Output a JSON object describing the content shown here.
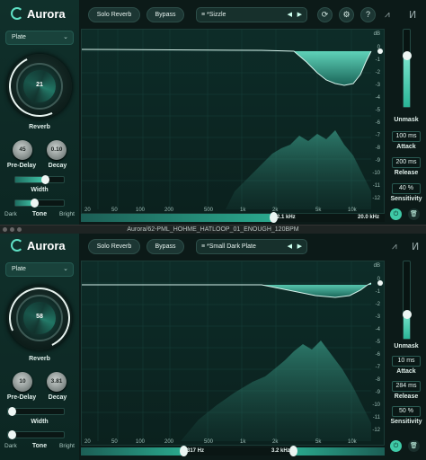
{
  "window_title": "Aurora/62-PML_HOHME_HATLOOP_01_ENOUGH_120BPM",
  "instances": [
    {
      "logo": "Aurora",
      "preset_type": "Plate",
      "solo_label": "Solo Reverb",
      "bypass_label": "Bypass",
      "preset_name": "*Sizzle",
      "reverb_value": "21",
      "reverb_label": "Reverb",
      "predelay_value": "45",
      "predelay_label": "Pre-Delay",
      "decay_value": "0.10",
      "decay_label": "Decay",
      "width_label": "Width",
      "width_level": 0.62,
      "tone_left": "Dark",
      "tone_label": "Tone",
      "tone_right": "Bright",
      "tone_level": 0.4,
      "unmask_label": "Unmask",
      "unmask_level": 0.68,
      "attack_value": "100 ms",
      "attack_label": "Attack",
      "release_value": "200 ms",
      "release_label": "Release",
      "sensitivity_value": "40 %",
      "sensitivity_label": "Sensitivity",
      "range_low": "2.1 kHz",
      "range_high": "20.0 kHz",
      "low_handle": 0.58,
      "high_handle": 1.0
    },
    {
      "logo": "Aurora",
      "preset_type": "Plate",
      "solo_label": "Solo Reverb",
      "bypass_label": "Bypass",
      "preset_name": "*Small Dark Plate",
      "reverb_value": "58",
      "reverb_label": "Reverb",
      "predelay_value": "10",
      "predelay_label": "Pre-Delay",
      "decay_value": "3.81",
      "decay_label": "Decay",
      "width_label": "Width",
      "width_level": 0.0,
      "tone_left": "Dark",
      "tone_label": "Tone",
      "tone_right": "Bright",
      "tone_level": 0.0,
      "unmask_label": "Unmask",
      "unmask_level": 0.35,
      "attack_value": "10 ms",
      "attack_label": "Attack",
      "release_value": "284 ms",
      "release_label": "Release",
      "sensitivity_value": "50 %",
      "sensitivity_label": "Sensitivity",
      "range_low": "317 Hz",
      "range_high": "3.2 kHz",
      "low_handle": 0.34,
      "high_handle": 0.69
    }
  ],
  "db_labels": [
    "dB",
    "0",
    "-1",
    "-2",
    "-3",
    "-4",
    "-5",
    "-6",
    "-7",
    "-8",
    "-9",
    "-10",
    "-11",
    "-12"
  ],
  "freq_labels": [
    "20",
    "50",
    "100",
    "200",
    "500",
    "1k",
    "2k",
    "5k",
    "10k"
  ],
  "icons": {
    "reset": "reset-icon",
    "settings": "gear-icon",
    "help": "question-icon",
    "prev": "arrow-left-icon",
    "next": "arrow-right-icon",
    "power": "power-icon",
    "trash": "trash-icon"
  },
  "accent": "#41c7a9"
}
